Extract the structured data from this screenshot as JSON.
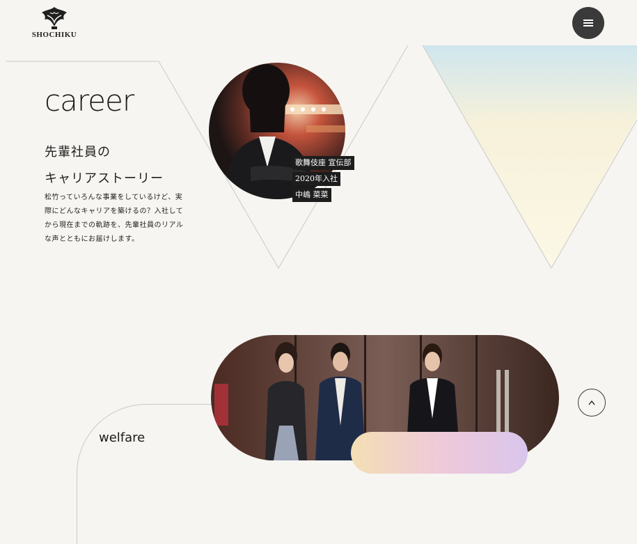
{
  "header": {
    "logo_text": "SHOCHIKU",
    "menu_icon": "hamburger-menu-icon"
  },
  "career": {
    "title": "career",
    "subtitle_line1": "先輩社員の",
    "subtitle_line2": "キャリアストーリー",
    "description": "松竹っていろんな事業をしているけど、実際にどんなキャリアを築けるの？入社してから現在までの軌跡を、先輩社員のリアルな声とともにお届けします。",
    "employee": {
      "department": "歌舞伎座 宣伝部",
      "year": "2020年入社",
      "name": "中嶋 菜菜"
    }
  },
  "welfare": {
    "title": "welfare"
  },
  "scroll_top_icon": "chevron-up-icon",
  "colors": {
    "background": "#f6f5f1",
    "menu_button": "#3a3a3a",
    "tag_background": "#1d1d1d"
  }
}
